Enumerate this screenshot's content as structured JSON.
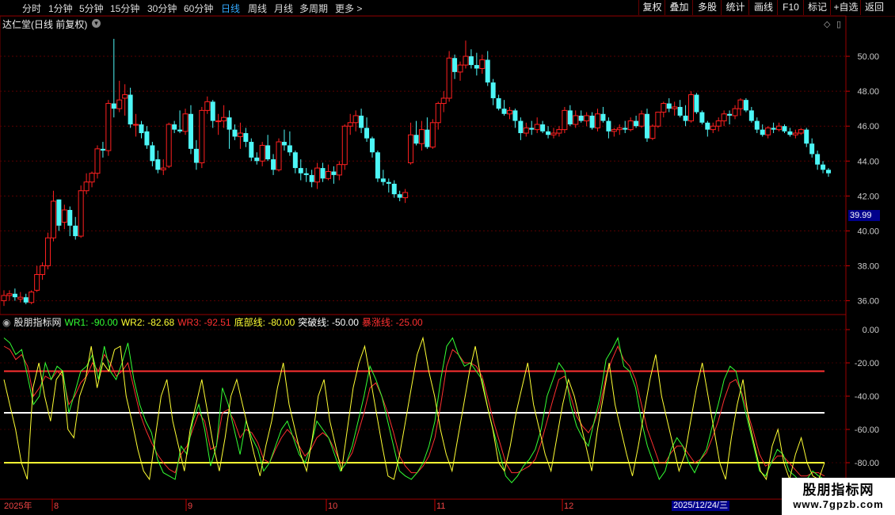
{
  "toolbar": {
    "timeframes": [
      "分时",
      "1分钟",
      "5分钟",
      "15分钟",
      "30分钟",
      "60分钟",
      "日线",
      "周线",
      "月线",
      "多周期",
      "更多 >"
    ],
    "active_timeframe": "日线",
    "right_buttons": [
      "复权",
      "叠加",
      "多股",
      "统计",
      "画线",
      "F10",
      "标记",
      "+自选",
      "返回"
    ]
  },
  "main_chart": {
    "title": "达仁堂(日线 前复权)",
    "price_ticks": [
      "50.00",
      "48.00",
      "46.00",
      "44.00",
      "42.00",
      "40.00",
      "38.00",
      "36.00"
    ],
    "current_price_label": "39.99",
    "up_color": "#ff2020",
    "down_color": "#4df7f7"
  },
  "indicator": {
    "name": "股朋指标网",
    "labels": [
      {
        "text": "WR1: -90.00",
        "color": "#33ff33"
      },
      {
        "text": "WR2: -82.68",
        "color": "#ffff33"
      },
      {
        "text": "WR3: -92.51",
        "color": "#ff3030"
      },
      {
        "text": "底部线: -80.00",
        "color": "#ffff33"
      },
      {
        "text": "突破线: -50.00",
        "color": "#ffffff"
      },
      {
        "text": "暴涨线: -25.00",
        "color": "#ff3030"
      }
    ],
    "ticks": [
      "0.00",
      "-20.00",
      "-40.00",
      "-60.00",
      "-80.00"
    ]
  },
  "date_axis": {
    "labels": [
      "2025年",
      "8",
      "9",
      "10",
      "11",
      "12"
    ],
    "highlight": "2025/12/24/三"
  },
  "watermark": {
    "line1": "股朋指标网",
    "line2": "www.7gpzb.com"
  },
  "chart_data": {
    "type": "candlestick",
    "candles": [
      [
        36.0,
        36.6,
        35.7,
        36.3
      ],
      [
        36.3,
        36.6,
        36.0,
        36.4
      ],
      [
        36.4,
        36.7,
        36.0,
        36.2
      ],
      [
        36.1,
        36.5,
        35.9,
        36.2
      ],
      [
        36.2,
        36.4,
        35.8,
        35.9
      ],
      [
        35.9,
        36.6,
        35.8,
        36.5
      ],
      [
        36.6,
        38.0,
        36.5,
        37.5
      ],
      [
        37.5,
        38.2,
        37.2,
        38.0
      ],
      [
        38.0,
        39.9,
        37.8,
        39.6
      ],
      [
        39.6,
        42.3,
        39.4,
        41.7
      ],
      [
        41.8,
        41.8,
        40.0,
        40.3
      ],
      [
        40.5,
        41.5,
        40.1,
        41.2
      ],
      [
        41.2,
        41.4,
        39.7,
        40.3
      ],
      [
        40.3,
        40.8,
        39.5,
        39.7
      ],
      [
        39.7,
        42.6,
        39.6,
        42.3
      ],
      [
        42.3,
        43.3,
        42.1,
        42.8
      ],
      [
        42.8,
        43.4,
        42.5,
        43.3
      ],
      [
        43.3,
        44.9,
        43.0,
        44.7
      ],
      [
        44.7,
        45.1,
        44.2,
        44.6
      ],
      [
        44.6,
        47.5,
        44.3,
        47.3
      ],
      [
        47.3,
        51.0,
        46.5,
        47.0
      ],
      [
        47.0,
        48.6,
        46.8,
        47.5
      ],
      [
        47.6,
        48.4,
        46.6,
        47.8
      ],
      [
        47.8,
        48.2,
        45.9,
        46.1
      ],
      [
        46.1,
        46.7,
        45.4,
        46.1
      ],
      [
        46.1,
        46.3,
        45.3,
        45.6
      ],
      [
        45.7,
        46.0,
        44.7,
        44.9
      ],
      [
        44.9,
        45.1,
        43.7,
        44.0
      ],
      [
        44.1,
        44.6,
        43.3,
        43.5
      ],
      [
        43.5,
        44.1,
        43.2,
        43.6
      ],
      [
        43.7,
        46.2,
        43.6,
        46.1
      ],
      [
        46.1,
        46.3,
        45.6,
        45.8
      ],
      [
        45.8,
        46.9,
        45.6,
        45.7
      ],
      [
        45.7,
        47.0,
        45.5,
        46.7
      ],
      [
        46.7,
        47.2,
        44.4,
        44.7
      ],
      [
        44.7,
        45.2,
        43.5,
        43.9
      ],
      [
        43.9,
        47.1,
        43.6,
        46.9
      ],
      [
        46.9,
        47.7,
        46.7,
        47.4
      ],
      [
        47.4,
        47.5,
        45.9,
        46.3
      ],
      [
        46.3,
        46.7,
        45.5,
        46.3
      ],
      [
        46.3,
        47.2,
        45.9,
        46.5
      ],
      [
        46.5,
        46.9,
        44.7,
        45.8
      ],
      [
        45.8,
        46.1,
        45.2,
        45.4
      ],
      [
        45.4,
        46.2,
        44.7,
        45.6
      ],
      [
        45.6,
        45.9,
        44.8,
        45.1
      ],
      [
        45.1,
        45.3,
        44.0,
        44.2
      ],
      [
        44.2,
        44.5,
        43.8,
        44.0
      ],
      [
        44.0,
        45.1,
        43.7,
        44.9
      ],
      [
        44.9,
        45.5,
        44.0,
        44.1
      ],
      [
        44.1,
        44.4,
        43.2,
        43.5
      ],
      [
        43.5,
        45.3,
        43.4,
        45.1
      ],
      [
        45.1,
        45.8,
        44.6,
        44.9
      ],
      [
        44.9,
        45.7,
        44.3,
        44.5
      ],
      [
        44.5,
        44.6,
        43.3,
        43.6
      ],
      [
        43.6,
        44.1,
        42.9,
        43.3
      ],
      [
        43.3,
        43.6,
        42.8,
        43.2
      ],
      [
        43.2,
        43.5,
        42.5,
        42.8
      ],
      [
        42.8,
        43.9,
        42.4,
        43.6
      ],
      [
        43.6,
        43.9,
        42.8,
        43.0
      ],
      [
        43.0,
        43.8,
        42.9,
        43.4
      ],
      [
        43.4,
        43.7,
        42.7,
        43.2
      ],
      [
        43.2,
        44.0,
        42.9,
        43.8
      ],
      [
        43.8,
        46.1,
        43.5,
        46.0
      ],
      [
        46.0,
        46.7,
        45.5,
        46.2
      ],
      [
        46.2,
        46.9,
        45.7,
        46.6
      ],
      [
        46.6,
        47.0,
        45.6,
        45.9
      ],
      [
        45.9,
        46.5,
        45.1,
        45.3
      ],
      [
        45.3,
        45.4,
        44.2,
        44.5
      ],
      [
        44.5,
        44.6,
        42.8,
        43.0
      ],
      [
        43.0,
        43.5,
        42.6,
        42.8
      ],
      [
        42.8,
        43.0,
        42.2,
        42.7
      ],
      [
        42.7,
        42.9,
        41.9,
        42.1
      ],
      [
        42.1,
        42.3,
        41.7,
        41.9
      ],
      [
        41.9,
        42.4,
        41.6,
        42.2
      ],
      [
        43.9,
        46.2,
        43.8,
        45.5
      ],
      [
        45.5,
        46.3,
        44.9,
        45.0
      ],
      [
        45.0,
        46.3,
        44.6,
        45.8
      ],
      [
        45.8,
        46.5,
        44.7,
        44.8
      ],
      [
        44.8,
        46.4,
        44.7,
        46.2
      ],
      [
        46.2,
        47.4,
        45.8,
        47.3
      ],
      [
        47.3,
        48.0,
        46.8,
        47.6
      ],
      [
        47.6,
        50.3,
        47.4,
        49.9
      ],
      [
        49.9,
        50.1,
        48.7,
        49.1
      ],
      [
        49.1,
        49.7,
        48.6,
        49.5
      ],
      [
        49.5,
        50.9,
        49.3,
        50.0
      ],
      [
        50.0,
        50.4,
        49.3,
        49.5
      ],
      [
        49.5,
        50.2,
        48.9,
        49.3
      ],
      [
        49.3,
        50.1,
        49.0,
        49.8
      ],
      [
        49.8,
        50.3,
        48.3,
        48.5
      ],
      [
        48.5,
        48.7,
        47.2,
        47.6
      ],
      [
        47.6,
        47.8,
        46.9,
        47.0
      ],
      [
        47.0,
        47.5,
        46.6,
        46.7
      ],
      [
        46.7,
        47.1,
        46.4,
        46.9
      ],
      [
        46.9,
        47.0,
        45.9,
        46.3
      ],
      [
        46.3,
        46.5,
        45.2,
        45.6
      ],
      [
        45.6,
        46.2,
        45.4,
        45.9
      ],
      [
        45.9,
        46.3,
        45.5,
        45.8
      ],
      [
        45.8,
        46.5,
        45.6,
        46.1
      ],
      [
        46.1,
        46.3,
        45.6,
        45.7
      ],
      [
        45.7,
        46.0,
        45.3,
        45.5
      ],
      [
        45.5,
        45.9,
        45.3,
        45.6
      ],
      [
        45.6,
        46.0,
        45.4,
        45.8
      ],
      [
        45.8,
        47.1,
        45.6,
        46.9
      ],
      [
        46.9,
        47.2,
        46.0,
        46.1
      ],
      [
        46.1,
        46.9,
        45.9,
        46.6
      ],
      [
        46.6,
        46.9,
        46.2,
        46.3
      ],
      [
        46.3,
        46.8,
        46.0,
        46.6
      ],
      [
        46.6,
        46.8,
        45.8,
        45.9
      ],
      [
        45.9,
        47.0,
        45.7,
        46.7
      ],
      [
        46.7,
        47.1,
        46.2,
        46.3
      ],
      [
        46.3,
        46.5,
        45.3,
        45.7
      ],
      [
        45.7,
        45.9,
        45.4,
        45.8
      ],
      [
        45.8,
        46.1,
        45.5,
        45.9
      ],
      [
        45.9,
        46.3,
        45.6,
        45.8
      ],
      [
        45.8,
        46.5,
        45.7,
        46.3
      ],
      [
        46.3,
        46.6,
        45.9,
        46.0
      ],
      [
        46.0,
        46.9,
        45.9,
        46.7
      ],
      [
        46.7,
        47.0,
        45.1,
        45.3
      ],
      [
        45.3,
        46.1,
        45.2,
        46.0
      ],
      [
        46.0,
        46.8,
        45.9,
        46.8
      ],
      [
        46.8,
        47.4,
        46.5,
        47.3
      ],
      [
        47.3,
        47.6,
        46.8,
        47.0
      ],
      [
        47.0,
        47.4,
        46.6,
        47.1
      ],
      [
        47.1,
        47.5,
        46.5,
        46.6
      ],
      [
        46.6,
        47.2,
        46.0,
        46.3
      ],
      [
        46.3,
        48.0,
        46.2,
        47.8
      ],
      [
        47.8,
        47.9,
        46.7,
        46.8
      ],
      [
        46.8,
        46.9,
        46.1,
        46.2
      ],
      [
        46.2,
        46.3,
        45.4,
        45.8
      ],
      [
        45.8,
        46.2,
        45.6,
        46.0
      ],
      [
        46.0,
        46.5,
        45.7,
        46.3
      ],
      [
        46.3,
        46.9,
        46.0,
        46.7
      ],
      [
        46.7,
        46.9,
        46.1,
        46.6
      ],
      [
        46.6,
        47.2,
        46.4,
        47.0
      ],
      [
        47.0,
        47.6,
        46.6,
        47.5
      ],
      [
        47.5,
        47.6,
        46.8,
        46.9
      ],
      [
        46.9,
        47.1,
        46.2,
        46.3
      ],
      [
        46.3,
        46.5,
        45.6,
        45.8
      ],
      [
        45.8,
        46.1,
        45.4,
        45.5
      ],
      [
        45.5,
        46.0,
        45.3,
        45.9
      ],
      [
        45.9,
        46.2,
        45.6,
        45.8
      ],
      [
        45.8,
        46.2,
        45.7,
        46.0
      ],
      [
        46.0,
        46.1,
        45.6,
        45.7
      ],
      [
        45.7,
        45.9,
        45.4,
        45.5
      ],
      [
        45.5,
        45.8,
        45.3,
        45.6
      ],
      [
        45.6,
        45.9,
        45.5,
        45.8
      ],
      [
        45.8,
        45.9,
        44.8,
        45.0
      ],
      [
        45.0,
        45.3,
        44.2,
        44.4
      ],
      [
        44.4,
        44.6,
        43.5,
        43.8
      ],
      [
        43.8,
        44.0,
        43.3,
        43.5
      ],
      [
        43.5,
        43.6,
        43.1,
        43.3
      ]
    ],
    "wr1": [
      -5,
      -8,
      -15,
      -12,
      -28,
      -45,
      -40,
      -20,
      -30,
      -22,
      -25,
      -50,
      -38,
      -25,
      -22,
      -15,
      -30,
      -10,
      -25,
      -30,
      -20,
      -8,
      -30,
      -45,
      -55,
      -62,
      -78,
      -86,
      -88,
      -90,
      -70,
      -75,
      -55,
      -45,
      -60,
      -82,
      -70,
      -35,
      -45,
      -60,
      -75,
      -55,
      -65,
      -72,
      -85,
      -80,
      -70,
      -60,
      -55,
      -65,
      -75,
      -80,
      -70,
      -55,
      -60,
      -65,
      -75,
      -85,
      -80,
      -70,
      -55,
      -40,
      -22,
      -30,
      -40,
      -55,
      -70,
      -85,
      -88,
      -90,
      -86,
      -80,
      -70,
      -55,
      -30,
      -10,
      -5,
      -15,
      -22,
      -20,
      -25,
      -30,
      -48,
      -62,
      -75,
      -88,
      -92,
      -88,
      -82,
      -78,
      -72,
      -60,
      -40,
      -30,
      -20,
      -25,
      -45,
      -58,
      -65,
      -70,
      -55,
      -40,
      -18,
      -12,
      -5,
      -22,
      -25,
      -35,
      -55,
      -70,
      -80,
      -90,
      -85,
      -72,
      -65,
      -70,
      -80,
      -86,
      -78,
      -72,
      -58,
      -45,
      -30,
      -22,
      -25,
      -40,
      -55,
      -70,
      -85,
      -88,
      -80,
      -72,
      -75,
      -85,
      -88,
      -92,
      -90,
      -85,
      -88,
      -90
    ],
    "wr2": [
      -30,
      -45,
      -60,
      -80,
      -90,
      -35,
      -20,
      -40,
      -55,
      -30,
      -25,
      -60,
      -65,
      -40,
      -30,
      -10,
      -35,
      -20,
      -25,
      -12,
      -10,
      -40,
      -55,
      -72,
      -85,
      -90,
      -65,
      -40,
      -30,
      -55,
      -70,
      -85,
      -60,
      -45,
      -30,
      -50,
      -70,
      -85,
      -65,
      -40,
      -30,
      -45,
      -60,
      -75,
      -88,
      -70,
      -55,
      -35,
      -20,
      -45,
      -60,
      -75,
      -85,
      -65,
      -40,
      -30,
      -55,
      -70,
      -85,
      -60,
      -35,
      -20,
      -10,
      -30,
      -50,
      -70,
      -88,
      -90,
      -75,
      -55,
      -35,
      -15,
      -5,
      -25,
      -40,
      -60,
      -75,
      -85,
      -65,
      -45,
      -25,
      -10,
      -30,
      -45,
      -60,
      -80,
      -85,
      -70,
      -50,
      -35,
      -20,
      -45,
      -60,
      -75,
      -85,
      -65,
      -45,
      -30,
      -40,
      -55,
      -70,
      -85,
      -60,
      -40,
      -20,
      -45,
      -60,
      -75,
      -88,
      -70,
      -50,
      -30,
      -15,
      -40,
      -55,
      -70,
      -85,
      -75,
      -55,
      -35,
      -20,
      -40,
      -60,
      -80,
      -90,
      -65,
      -45,
      -30,
      -55,
      -70,
      -85,
      -90,
      -70,
      -60,
      -80,
      -90,
      -75,
      -65,
      -80,
      -88,
      -90,
      -80
    ],
    "wr3": [
      -10,
      -12,
      -18,
      -15,
      -22,
      -40,
      -35,
      -28,
      -30,
      -25,
      -28,
      -45,
      -40,
      -32,
      -28,
      -20,
      -25,
      -15,
      -20,
      -28,
      -25,
      -20,
      -35,
      -50,
      -60,
      -68,
      -75,
      -80,
      -84,
      -86,
      -75,
      -70,
      -60,
      -50,
      -55,
      -72,
      -70,
      -50,
      -48,
      -55,
      -65,
      -60,
      -62,
      -68,
      -78,
      -80,
      -72,
      -65,
      -60,
      -64,
      -70,
      -76,
      -72,
      -65,
      -62,
      -65,
      -72,
      -80,
      -80,
      -74,
      -62,
      -50,
      -35,
      -32,
      -40,
      -50,
      -62,
      -76,
      -82,
      -86,
      -86,
      -82,
      -76,
      -65,
      -45,
      -22,
      -12,
      -15,
      -20,
      -20,
      -22,
      -28,
      -42,
      -56,
      -68,
      -80,
      -86,
      -86,
      -84,
      -82,
      -78,
      -68,
      -55,
      -42,
      -30,
      -28,
      -40,
      -52,
      -58,
      -62,
      -56,
      -45,
      -28,
      -18,
      -10,
      -18,
      -22,
      -30,
      -45,
      -60,
      -70,
      -80,
      -80,
      -74,
      -70,
      -70,
      -75,
      -80,
      -78,
      -74,
      -65,
      -55,
      -42,
      -32,
      -30,
      -38,
      -50,
      -62,
      -75,
      -82,
      -80,
      -76,
      -76,
      -80,
      -84,
      -88,
      -88,
      -86,
      -86,
      -88
    ]
  }
}
